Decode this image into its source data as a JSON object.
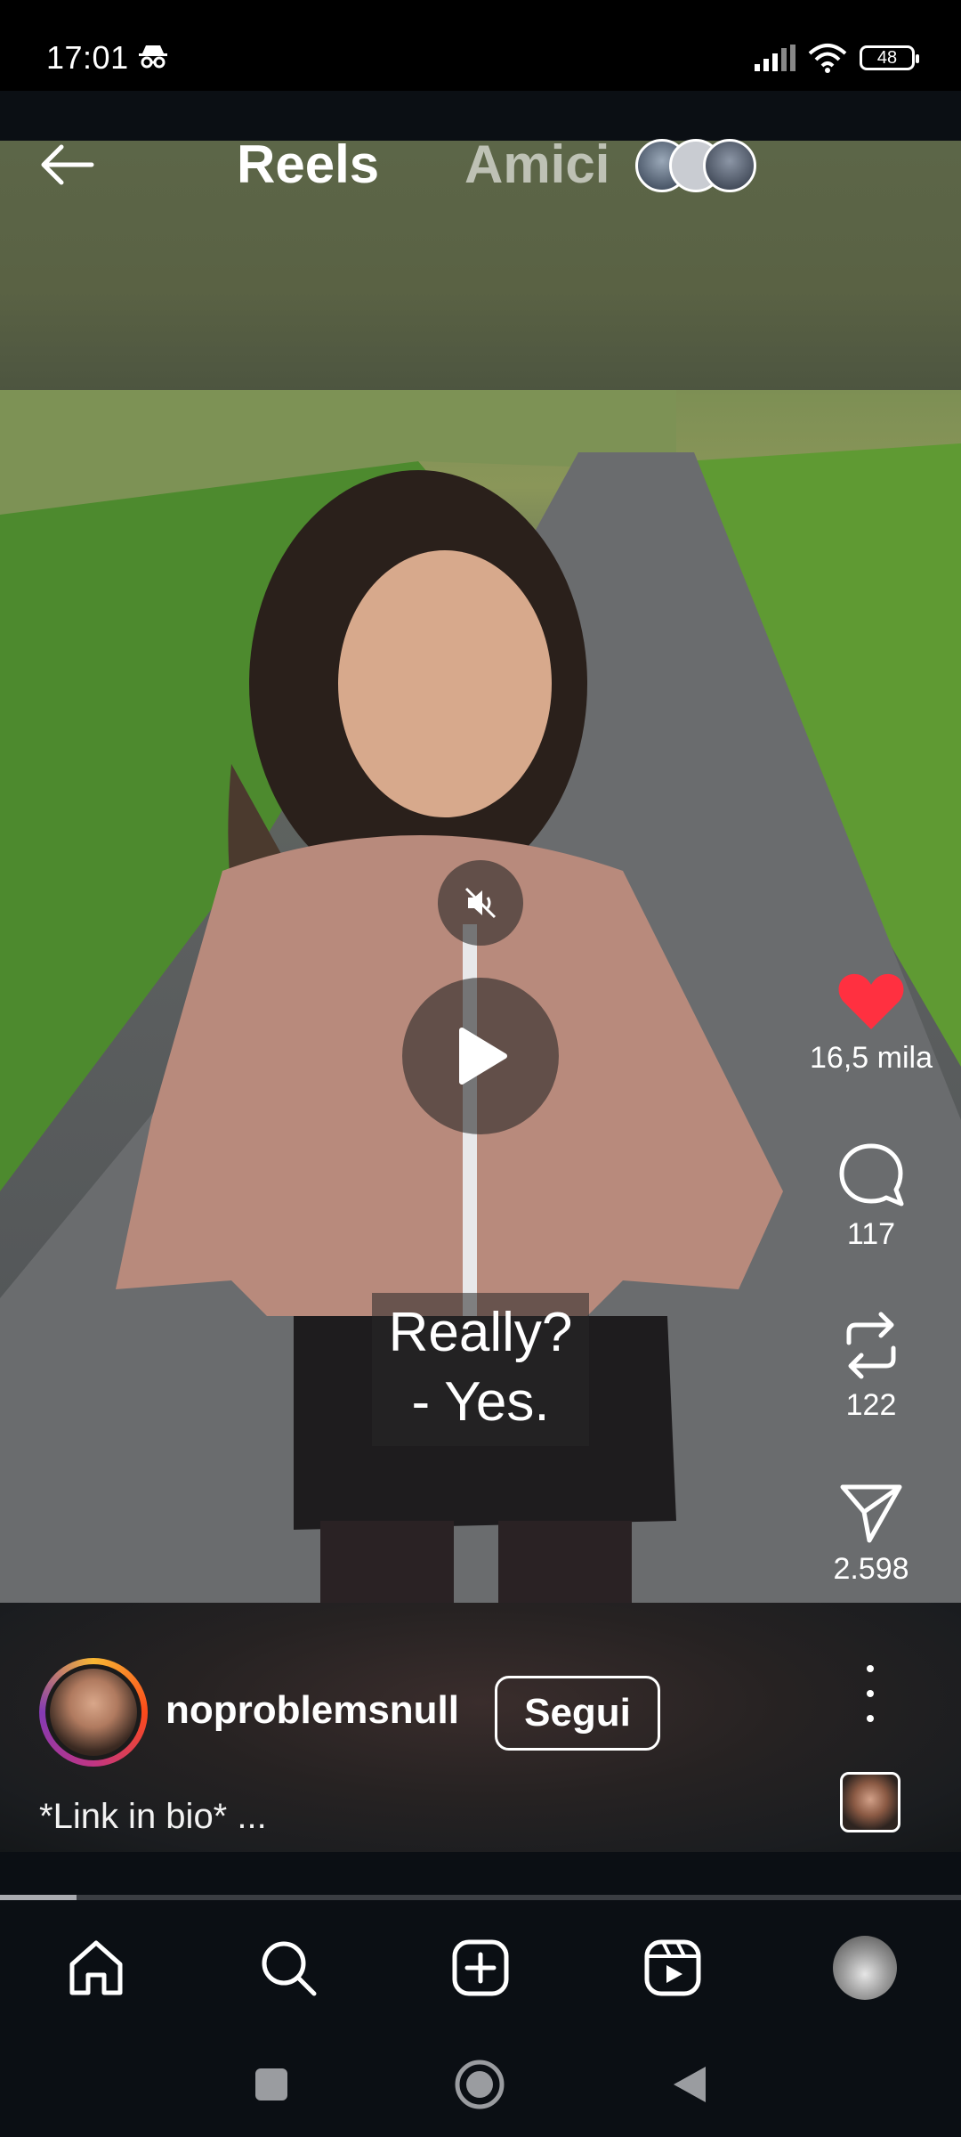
{
  "status_bar": {
    "time": "17:01",
    "battery": "48"
  },
  "header": {
    "tabs": [
      {
        "label": "Reels",
        "active": true
      },
      {
        "label": "Amici",
        "active": false
      }
    ]
  },
  "video": {
    "subtitle_line1": "Really?",
    "subtitle_line2": "- Yes.",
    "playback": "paused",
    "muted": true,
    "progress": 0.08
  },
  "actions": {
    "likes": "16,5 mila",
    "comments": "117",
    "reposts": "122",
    "shares": "2.598",
    "like_color": "#ff3040"
  },
  "author": {
    "username": "noproblemsnull",
    "follow_label": "Segui",
    "caption": "*Link in bio* ..."
  },
  "bottom_nav": [
    "home-icon",
    "search-icon",
    "create-icon",
    "reels-icon",
    "profile-avatar"
  ],
  "system_nav": [
    "recents",
    "home",
    "back"
  ]
}
